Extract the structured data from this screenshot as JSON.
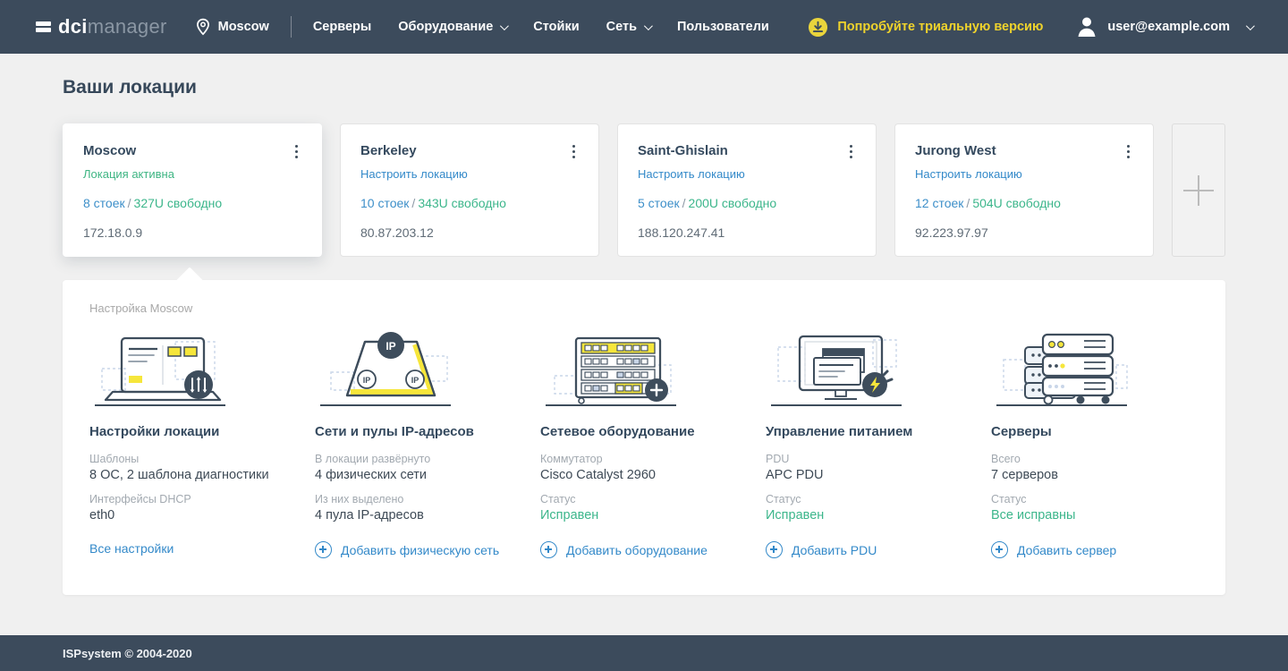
{
  "navbar": {
    "logo_bold": "dci",
    "logo_light": "manager",
    "current_location": "Moscow",
    "menu": [
      {
        "label": "Серверы",
        "has_dropdown": false
      },
      {
        "label": "Оборудование",
        "has_dropdown": true
      },
      {
        "label": "Стойки",
        "has_dropdown": false
      },
      {
        "label": "Сеть",
        "has_dropdown": true
      },
      {
        "label": "Пользователи",
        "has_dropdown": false
      }
    ],
    "trial_label": "Попробуйте триальную версию",
    "user_email": "user@example.com"
  },
  "page_title": "Ваши локации",
  "capacity_separator": "/",
  "cards": [
    {
      "name": "Moscow",
      "status": "Локация активна",
      "racks": "8 стоек",
      "free": "327U свободно",
      "ip": "172.18.0.9"
    },
    {
      "name": "Berkeley",
      "status": "Настроить локацию",
      "racks": "10 стоек",
      "free": "343U свободно",
      "ip": "80.87.203.12"
    },
    {
      "name": "Saint-Ghislain",
      "status": "Настроить локацию",
      "racks": "5 стоек",
      "free": "200U свободно",
      "ip": "188.120.247.41"
    },
    {
      "name": "Jurong West",
      "status": "Настроить локацию",
      "racks": "12 стоек",
      "free": "504U свободно",
      "ip": "92.223.97.97"
    }
  ],
  "panel": {
    "title": "Настройка Moscow",
    "sections": [
      {
        "icon": "laptop-settings-illustration",
        "title": "Настройки локации",
        "rows": [
          {
            "label": "Шаблоны",
            "value": "8 ОС, 2 шаблона диагностики"
          },
          {
            "label": "Интерфейсы DHCP",
            "value": "eth0"
          }
        ],
        "action": "Все настройки"
      },
      {
        "icon": "ip-pool-illustration",
        "title": "Сети и пулы IP-адресов",
        "rows": [
          {
            "label": "В локации развёрнуто",
            "value": "4 физических сети"
          },
          {
            "label": "Из них выделено",
            "value": "4 пула IP-адресов"
          }
        ],
        "action": "Добавить физическую сеть"
      },
      {
        "icon": "network-switch-illustration",
        "title": "Сетевое оборудование",
        "rows": [
          {
            "label": "Коммутатор",
            "value": "Cisco Catalyst 2960"
          },
          {
            "label": "Статус",
            "value": "Исправен"
          }
        ],
        "action": "Добавить оборудование"
      },
      {
        "icon": "power-management-illustration",
        "title": "Управление питанием",
        "rows": [
          {
            "label": "PDU",
            "value": "APC PDU"
          },
          {
            "label": "Статус",
            "value": "Исправен"
          }
        ],
        "action": "Добавить PDU"
      },
      {
        "icon": "servers-illustration",
        "title": "Серверы",
        "rows": [
          {
            "label": "Всего",
            "value": "7 серверов"
          },
          {
            "label": "Статус",
            "value": "Все исправны"
          }
        ],
        "action": "Добавить сервер"
      }
    ]
  },
  "footer": {
    "copyright": "ISPsystem © 2004-2020"
  },
  "icons": {
    "location_pin": "map-pin-outline",
    "trial_badge": "download-circle",
    "user_avatar": "person-silhouette",
    "menu_expand": "chevron-down",
    "card_menu": "kebab-vertical-dots",
    "add_location": "plus",
    "section_action": "plus-circle"
  },
  "colors": {
    "navbar_bg": "#3c4b5c",
    "accent_yellow": "#efd32c",
    "link_blue": "#3389c9",
    "status_green": "#3eb583",
    "free_teal": "#3cb68b",
    "page_bg": "#f0f0f0"
  }
}
